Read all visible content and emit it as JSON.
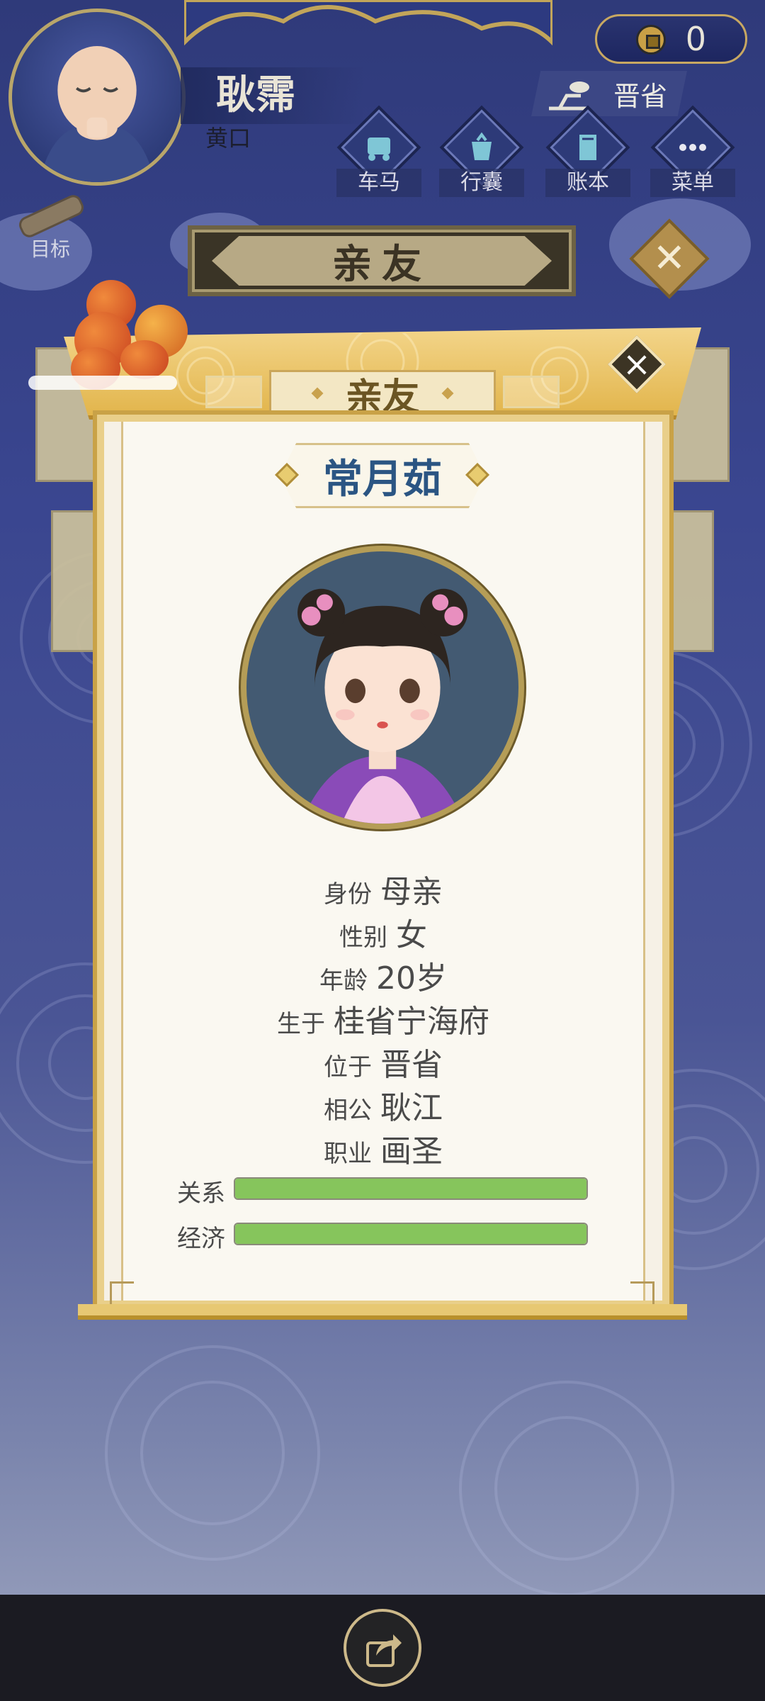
{
  "player": {
    "name": "耿霈",
    "title": "黄口"
  },
  "currency": {
    "icon": "coin-icon",
    "amount": "0"
  },
  "location": "晋省",
  "nav": [
    {
      "label": "车马",
      "icon": "carriage-icon"
    },
    {
      "label": "行囊",
      "icon": "bag-icon"
    },
    {
      "label": "账本",
      "icon": "ledger-icon"
    },
    {
      "label": "菜单",
      "icon": "menu-icon"
    }
  ],
  "goal_label": "目标",
  "section_title": "亲友",
  "modal": {
    "header": "亲友",
    "name": "常月茹",
    "info": [
      {
        "k": "身份",
        "v": "母亲"
      },
      {
        "k": "性别",
        "v": "女"
      },
      {
        "k": "年龄",
        "v": "20岁"
      },
      {
        "k": "生于",
        "v": "桂省宁海府"
      },
      {
        "k": "位于",
        "v": "晋省"
      },
      {
        "k": "相公",
        "v": "耿江"
      },
      {
        "k": "职业",
        "v": "画圣"
      }
    ],
    "bars": [
      {
        "label": "关系",
        "value": 1.0
      },
      {
        "label": "经济",
        "value": 1.0
      }
    ]
  },
  "colors": {
    "bar_fill": "#86c55c",
    "name_text": "#2b5583",
    "accent_gold": "#e2b54c"
  },
  "bottom": {
    "icon": "share-icon"
  }
}
